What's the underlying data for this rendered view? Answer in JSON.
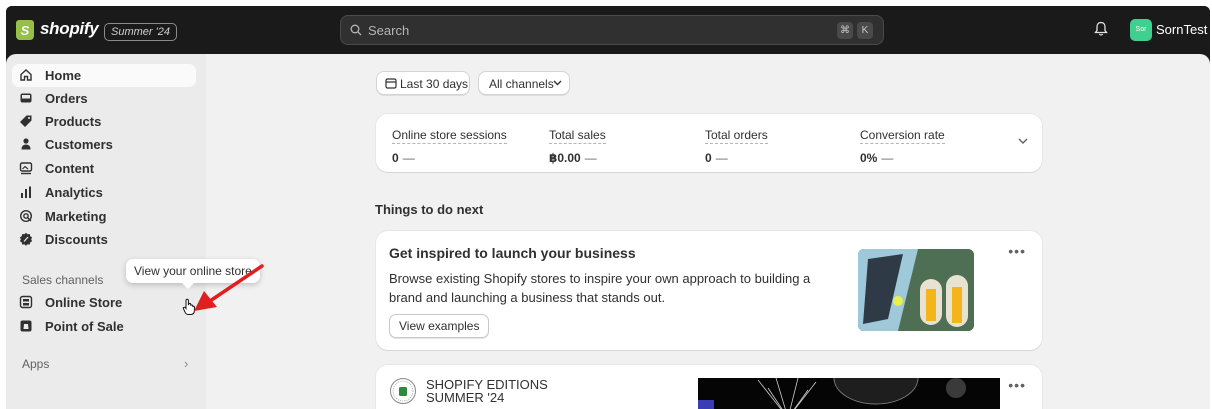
{
  "topbar": {
    "logo_mark": "S",
    "logo_text": "shopify",
    "edition_badge": "Summer '24",
    "search": {
      "placeholder": "Search",
      "shortcut_keys": [
        "⌘",
        "K"
      ]
    },
    "notifications_icon": "bell-icon",
    "avatar_initials": "Sor",
    "store_name": "SornTest"
  },
  "sidebar": {
    "items": [
      {
        "label": "Home",
        "icon": "home-icon",
        "active": true
      },
      {
        "label": "Orders",
        "icon": "inbox-icon"
      },
      {
        "label": "Products",
        "icon": "tag-icon"
      },
      {
        "label": "Customers",
        "icon": "person-icon"
      },
      {
        "label": "Content",
        "icon": "image-icon"
      },
      {
        "label": "Analytics",
        "icon": "bar-chart-icon"
      },
      {
        "label": "Marketing",
        "icon": "target-icon"
      },
      {
        "label": "Discounts",
        "icon": "discount-icon"
      }
    ],
    "sales_channels_label": "Sales channels",
    "channels": [
      {
        "label": "Online Store",
        "icon": "storefront-icon"
      },
      {
        "label": "Point of Sale",
        "icon": "pos-icon"
      }
    ],
    "apps_label": "Apps"
  },
  "tooltip": {
    "text": "View your online store"
  },
  "filters": {
    "date_range": "Last 30 days",
    "channel": "All channels"
  },
  "metrics": [
    {
      "label": "Online store sessions",
      "value": "0",
      "trend": "—"
    },
    {
      "label": "Total sales",
      "value": "฿0.00",
      "trend": "—"
    },
    {
      "label": "Total orders",
      "value": "0",
      "trend": "—"
    },
    {
      "label": "Conversion rate",
      "value": "0%",
      "trend": "—"
    }
  ],
  "things_to_do": {
    "title": "Things to do next",
    "promo": {
      "title": "Get inspired to launch your business",
      "body": "Browse existing Shopify stores to inspire your own approach to building a brand and launching a business that stands out.",
      "button": "View examples",
      "menu": "•••"
    },
    "editions": {
      "line1": "SHOPIFY EDITIONS",
      "line2": "SUMMER '24",
      "menu": "•••"
    }
  },
  "colors": {
    "topbar_bg": "#1a1a1a",
    "sidebar_bg": "#ebebeb",
    "main_bg": "#f1f1f1",
    "brand_green": "#95bf47",
    "avatar_green": "#3fcf8e",
    "annotation_red": "#e02020"
  }
}
